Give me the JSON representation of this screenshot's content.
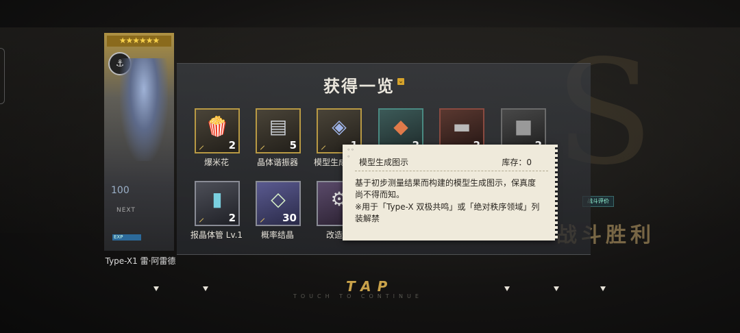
{
  "panel": {
    "title": "获得一览",
    "chevron": "⌄"
  },
  "character": {
    "stars": "★★★★★★",
    "badge_icon": "ship-emblem-icon",
    "level_text": "100",
    "next_text": "NEXT",
    "exp_text": "EXP",
    "name": "Type-X1 雷·阿雷德"
  },
  "items": [
    {
      "label": "爆米花",
      "qty": "2",
      "icon": "popcorn-icon"
    },
    {
      "label": "晶体谐振器",
      "qty": "5",
      "icon": "resonator-icon"
    },
    {
      "label": "模型生成图示",
      "qty": "1",
      "icon": "model-diagram-icon"
    },
    {
      "label": "",
      "qty": "2",
      "icon": "ore-icon"
    },
    {
      "label": "",
      "qty": "2",
      "icon": "steel-bar-icon"
    },
    {
      "label": "",
      "qty": "2",
      "icon": "metal-block-icon"
    },
    {
      "label": "报晶体管 Lv.1",
      "qty": "2",
      "icon": "transistor-icon"
    },
    {
      "label": "概率结晶",
      "qty": "30",
      "icon": "probability-crystal-icon"
    },
    {
      "label": "改造件",
      "qty": "",
      "icon": "gear-part-icon"
    }
  ],
  "tooltip": {
    "name": "模型生成图示",
    "stock": "库存：0",
    "description": "基于初步测量结果而构建的模型生成图示，保真度尚不得而知。",
    "usage": "※用于「Type-X 双极共鸣」或「绝对秩序领域」列装解禁"
  },
  "background": {
    "victory": "战斗胜利",
    "battle_eval": "战斗评价"
  },
  "footer": {
    "tap": "TAP",
    "touch": "TOUCH TO CONTINUE"
  }
}
